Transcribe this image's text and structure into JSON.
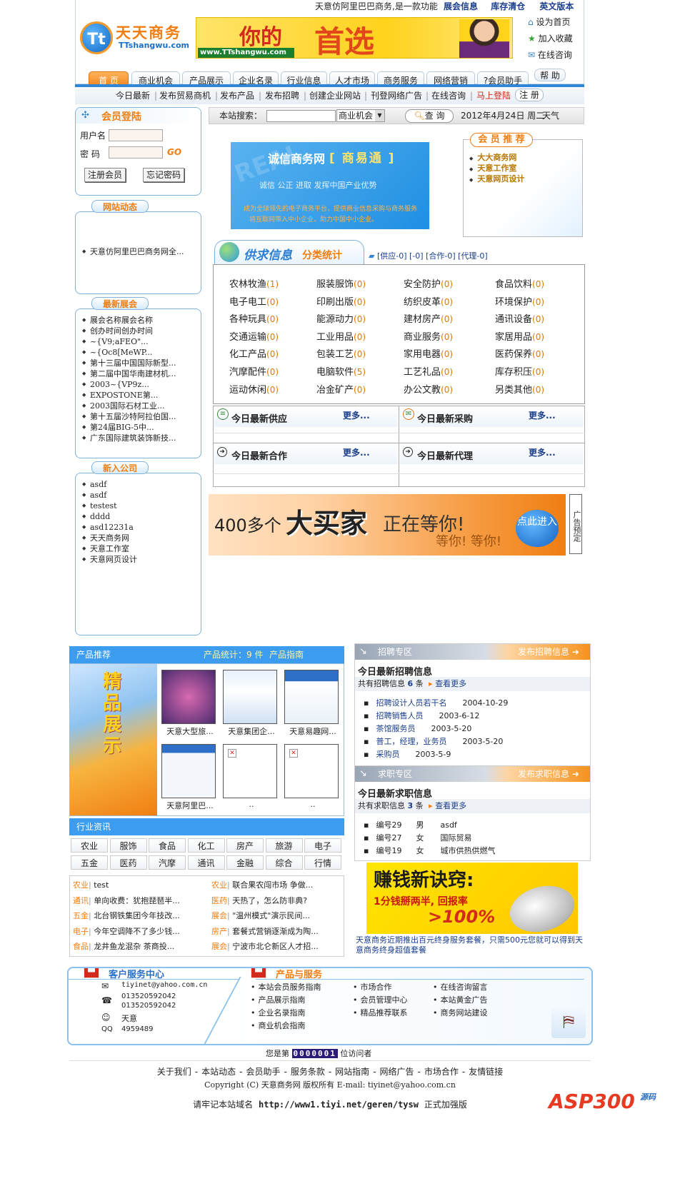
{
  "top_bar": {
    "notice": "天意仿阿里巴巴商务,是一款功能",
    "links": [
      "展会信息",
      "库存清仓",
      "英文版本"
    ]
  },
  "brand": {
    "logo_cn": "天天商务",
    "logo_en": "TTshangwu.com",
    "banner_big": "你的",
    "banner_big2": "首选",
    "banner_url": "www.TTshangwu.com"
  },
  "quick_links": [
    "设为首页",
    "加入收藏",
    "在线咨询"
  ],
  "nav": [
    "首 页",
    "商业机会",
    "产品展示",
    "企业名录",
    "行业信息",
    "人才市场",
    "商务服务",
    "网络营销",
    "?会员助手"
  ],
  "nav_help": "帮 助",
  "subnav": [
    "今日最新",
    "发布贸易商机",
    "发布产品",
    "发布招聘",
    "创建企业网站",
    "刊登网络广告",
    "在线咨询",
    "马上登陆"
  ],
  "subnav_register": "注 册",
  "login": {
    "title": "会员登陆",
    "user_label": "用户名",
    "pass_label": "密 码",
    "go": "GO",
    "register": "注册会员",
    "forgot": "忘记密码"
  },
  "site_news": {
    "title": "网站动态",
    "items": [
      "天意仿阿里巴巴商务网全..."
    ]
  },
  "exhibitions": {
    "title": "最新展会",
    "items": [
      "展会名称展会名称",
      "创办时间创办时间",
      "~{V9;aFEO\"...",
      "~{Oc8[MeWP...",
      "第十三届中国国际新型...",
      "第二届中国华南建材机...",
      "2003~{VP9z...",
      "EXPOSTONE第...",
      "2003国际石材工业...",
      "第十五届沙特阿拉伯国...",
      "第24届BIG-5中...",
      "广东国际建筑装饰新技..."
    ]
  },
  "new_companies": {
    "title": "新入公司",
    "items": [
      "asdf",
      "asdf",
      "testest",
      "dddd",
      "asd12231a",
      "天天商务网",
      "天意工作室",
      "天意网页设计"
    ]
  },
  "search": {
    "label": "本站搜索：",
    "select": "商业机会",
    "button": "查 询",
    "date": "2012年4月24日 周二",
    "weather": "天气"
  },
  "promo": {
    "title": "诚信商务网",
    "tag": "商易通",
    "slogan": "诚信 公正 进取 发挥中国产业优势",
    "line1": "成为全球领先的电子商务平台，提供商业信息采购与商务服务",
    "line2": "将互联网带入中小企业，助力中国中小企业。"
  },
  "member_rec": {
    "title": "会 员 推 荐",
    "items": [
      "大大商务网",
      "天意工作室",
      "天意网页设计"
    ]
  },
  "supply": {
    "title": "供求信息",
    "subtitle": "分类统计",
    "stats": "[供应-0] [-0] [合作-0] [代理-0]",
    "cats": [
      [
        "农林牧渔",
        "1"
      ],
      [
        "服装服饰",
        "0"
      ],
      [
        "安全防护",
        "0"
      ],
      [
        "食品饮料",
        "0"
      ],
      [
        "电子电工",
        "0"
      ],
      [
        "印刷出版",
        "0"
      ],
      [
        "纺织皮革",
        "0"
      ],
      [
        "环境保护",
        "0"
      ],
      [
        "各种玩具",
        "0"
      ],
      [
        "能源动力",
        "0"
      ],
      [
        "建材房产",
        "0"
      ],
      [
        "通讯设备",
        "0"
      ],
      [
        "交通运输",
        "0"
      ],
      [
        "工业用品",
        "0"
      ],
      [
        "商业服务",
        "0"
      ],
      [
        "家居用品",
        "0"
      ],
      [
        "化工产品",
        "0"
      ],
      [
        "包装工艺",
        "0"
      ],
      [
        "家用电器",
        "0"
      ],
      [
        "医药保养",
        "0"
      ],
      [
        "汽摩配件",
        "0"
      ],
      [
        "电脑软件",
        "5"
      ],
      [
        "工艺礼品",
        "0"
      ],
      [
        "库存积压",
        "0"
      ],
      [
        "运动休闲",
        "0"
      ],
      [
        "冶金矿产",
        "0"
      ],
      [
        "办公文教",
        "0"
      ],
      [
        "另类其他",
        "0"
      ]
    ]
  },
  "latest": [
    {
      "title": "今日最新供应",
      "more": "更多..."
    },
    {
      "title": "今日最新采购",
      "more": "更多..."
    },
    {
      "title": "今日最新合作",
      "more": "更多..."
    },
    {
      "title": "今日最新代理",
      "more": "更多..."
    }
  ],
  "big_banner": {
    "pre": "400多个",
    "big": "大买家",
    "post": "正在等你!",
    "sub": "等你! 等你!",
    "btn": "点此进入",
    "side": "广告预定"
  },
  "products": {
    "title": "产品推荐",
    "stats": "产品统计：9 件",
    "guide": "产品指南",
    "side": "精品展示",
    "items": [
      "天意大型旅...",
      "天意集团企...",
      "天意易趣网...",
      "天意阿里巴...",
      "..",
      ".."
    ]
  },
  "industry": {
    "title": "行业资讯",
    "tags": [
      "农业",
      "服饰",
      "食品",
      "化工",
      "房产",
      "旅游",
      "电子",
      "五金",
      "医药",
      "汽摩",
      "通讯",
      "金融",
      "综合",
      "行情"
    ],
    "news_left": [
      [
        "农业",
        "test"
      ],
      [
        "通讯",
        "单向收费：犹抱琵琶半..."
      ],
      [
        "五金",
        "北台钢铁集团今年技改..."
      ],
      [
        "电子",
        "今年空调降不了多少钱..."
      ],
      [
        "食品",
        "龙井鱼龙混杂 茶商投..."
      ]
    ],
    "news_right": [
      [
        "农业",
        "联合果农闯市场 争做..."
      ],
      [
        "医药",
        "天热了，怎么防非典?"
      ],
      [
        "展会",
        "\"温州模式\"演示民间..."
      ],
      [
        "房产",
        "套餐式营销逐渐成为陶..."
      ],
      [
        "展会",
        "宁波市北仑新区人才招..."
      ]
    ]
  },
  "jobs": {
    "zone": "招聘专区",
    "post": "发布招聘信息",
    "heading": "今日最新招聘信息",
    "count_pre": "共有招聘信息",
    "count": "6",
    "count_post": "条",
    "more": "查看更多",
    "items": [
      [
        "招聘设计人员若干名",
        "2004-10-29"
      ],
      [
        "招聘销售人员",
        "2003-6-12"
      ],
      [
        "茶馆服务员",
        "2003-5-20"
      ],
      [
        "普工，经理，业务员",
        "2003-5-20"
      ],
      [
        "采购员",
        "2003-5-9"
      ]
    ]
  },
  "seekers": {
    "zone": "求职专区",
    "post": "发布求职信息",
    "heading": "今日最新求职信息",
    "count_pre": "共有求职信息",
    "count": "3",
    "count_post": "条",
    "more": "查看更多",
    "items": [
      [
        "编号29",
        "男",
        "asdf"
      ],
      [
        "编号27",
        "女",
        "国际贸易"
      ],
      [
        "编号19",
        "女",
        "城市供热供燃气"
      ]
    ]
  },
  "money_ad": {
    "title": "赚钱新诀窍:",
    "line1": "1分钱掰两半, 回报率",
    "line2": ">100%",
    "desc": "天意商务近期推出百元终身服务套餐，只需500元您就可以得到天意商务终身超值套餐"
  },
  "service": {
    "title": "客户服务中心",
    "email": "tiyinet@yahoo.com.cn",
    "phone1": "013520592042",
    "phone2": "013520592042",
    "name": "天意",
    "qq_label": "QQ",
    "qq": "4959489"
  },
  "products_services": {
    "title": "产品与服务",
    "col1": [
      "本站会员服务指南",
      "产品展示指南",
      "企业名录指南",
      "商业机会指南"
    ],
    "col2": [
      "市场合作",
      "会员管理中心",
      "精品推荐联系"
    ],
    "col3": [
      "在线咨询留言",
      "本站黄金广告",
      "商务网站建设"
    ]
  },
  "visitor": {
    "pre": "您是第",
    "count": "0000001",
    "post": "位访问者"
  },
  "footer": {
    "links": [
      "关于我们",
      "本站动态",
      "会员助手",
      "服务条款",
      "网站指南",
      "网络广告",
      "市场合作",
      "友情链接"
    ],
    "copyright": "Copyright (C)  天意商务网 版权所有  E-mail: tiyinet@yahoo.com.cn",
    "remember": "请牢记本站域名",
    "url": "http://www1.tiyi.net/geren/tysw",
    "edition": "正式加强版",
    "watermark": "ASP300",
    "watermark2": "源码"
  },
  "colors": {
    "accent": "#f07e12",
    "blue": "#3388d6",
    "link": "#1a3e8c"
  }
}
